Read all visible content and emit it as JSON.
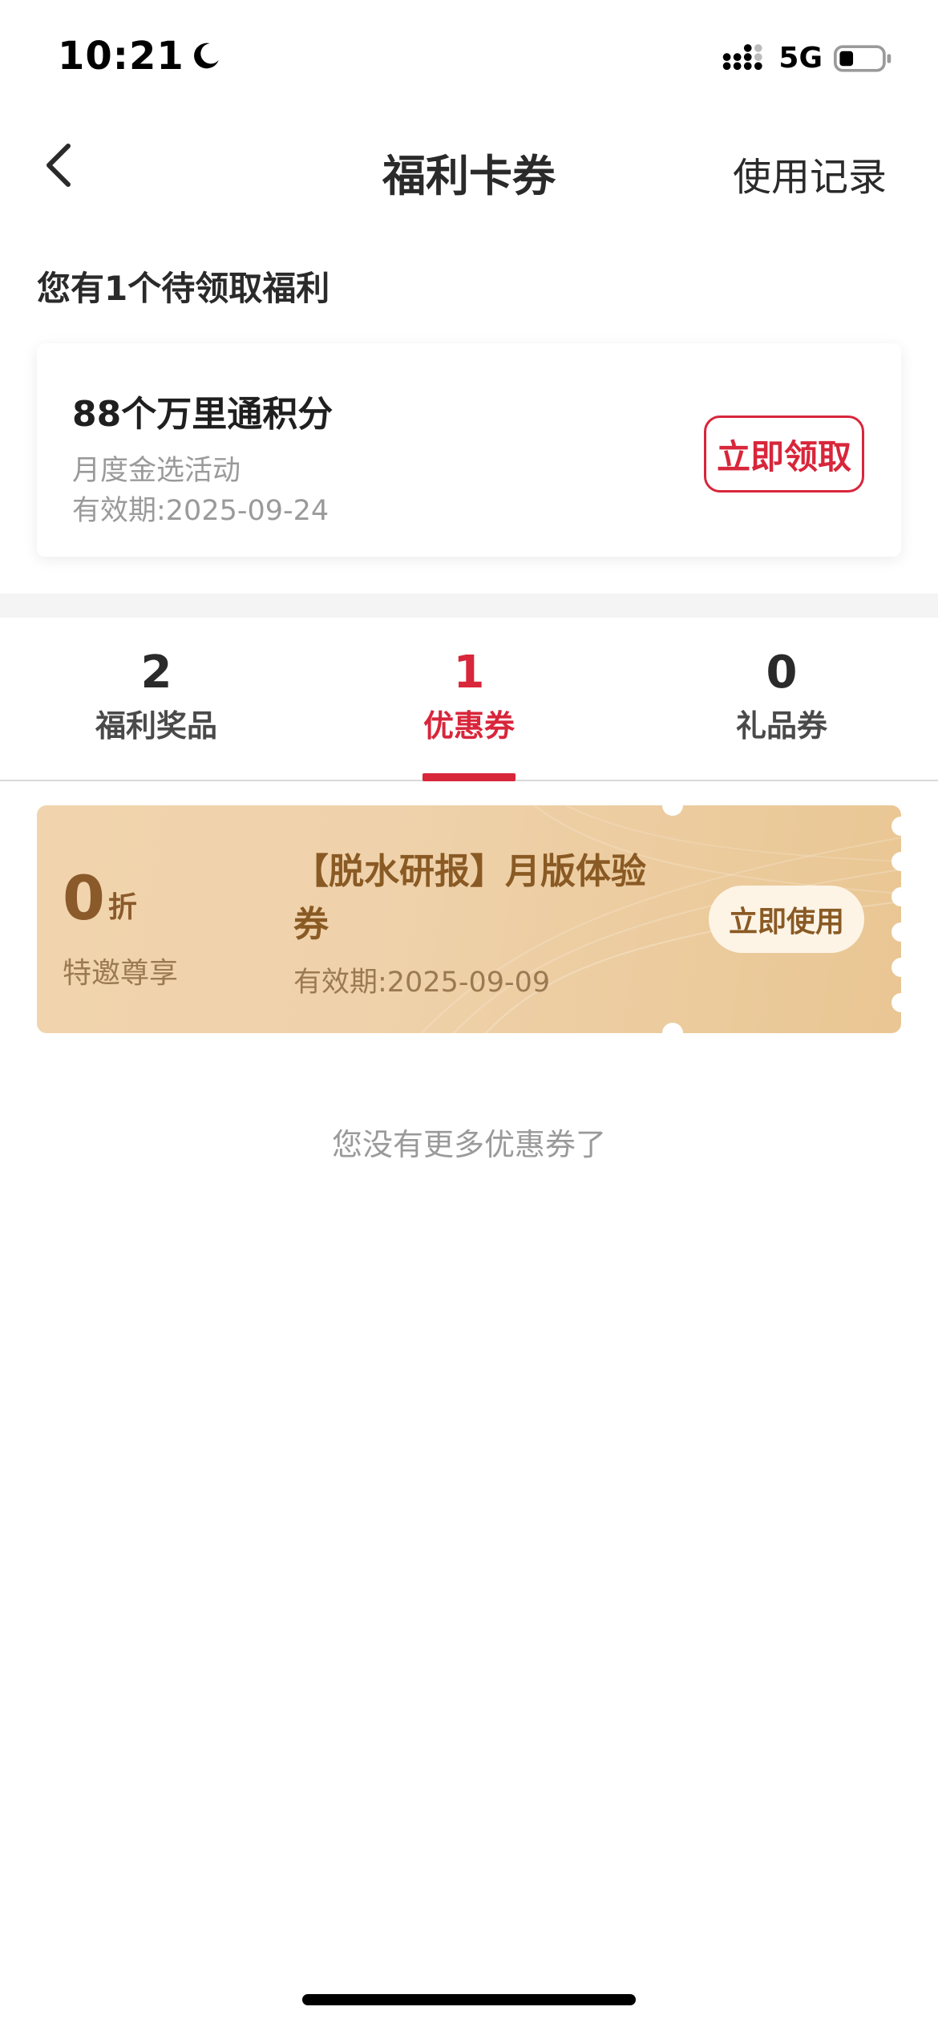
{
  "status_bar": {
    "time": "10:21",
    "network": "5G"
  },
  "nav": {
    "title": "福利卡券",
    "history_label": "使用记录"
  },
  "pending": {
    "heading": "您有1个待领取福利",
    "card": {
      "title": "88个万里通积分",
      "subtitle": "月度金选活动",
      "validity": "有效期:2025-09-24",
      "claim_label": "立即领取"
    }
  },
  "tabs": [
    {
      "count": "2",
      "label": "福利奖品",
      "active": false
    },
    {
      "count": "1",
      "label": "优惠券",
      "active": true
    },
    {
      "count": "0",
      "label": "礼品券",
      "active": false
    }
  ],
  "coupon": {
    "discount_value": "0",
    "discount_unit": "折",
    "discount_desc": "特邀尊享",
    "title": "【脱水研报】月版体验券",
    "validity": "有效期:2025-09-09",
    "use_label": "立即使用"
  },
  "footer_note": "您没有更多优惠券了",
  "colors": {
    "accent": "#d8263b",
    "coupon_text": "#8a5a24"
  }
}
